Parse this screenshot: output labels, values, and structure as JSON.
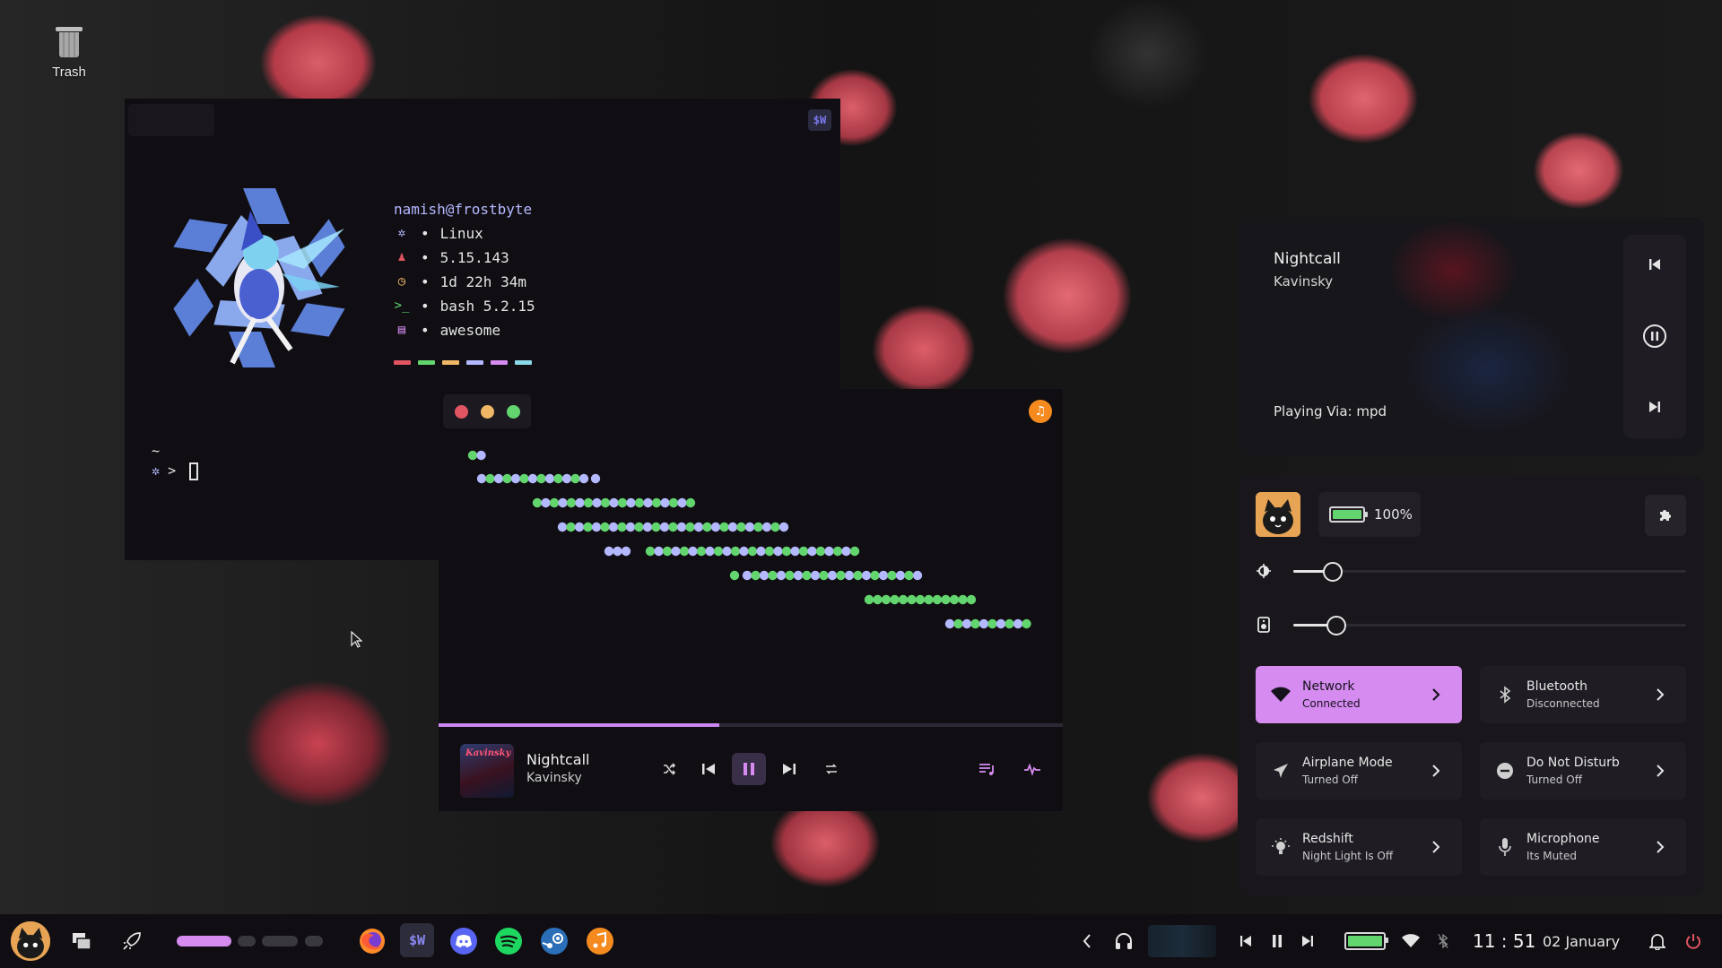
{
  "desktop": {
    "trash_label": "Trash"
  },
  "terminal": {
    "badge": "$W",
    "fetch": {
      "user_host": "namish@frostbyte",
      "rows": [
        {
          "icon": "gear-icon",
          "value": "Linux"
        },
        {
          "icon": "penguin-icon",
          "value": "5.15.143"
        },
        {
          "icon": "clock-icon",
          "value": "1d 22h 34m"
        },
        {
          "icon": "terminal-icon",
          "value": "bash 5.2.15"
        },
        {
          "icon": "window-icon",
          "value": "awesome"
        }
      ],
      "bullet": "•"
    },
    "palette": [
      "#e05561",
      "#63d56e",
      "#f0b866",
      "#b4b8ff",
      "#d58bf0",
      "#8bd9e8"
    ],
    "prompt_path": "~",
    "prompt_symbol": ">"
  },
  "player": {
    "badge": "♫",
    "track_title": "Nightcall",
    "track_artist": "Kavinsky",
    "art_text": "Kavinsky",
    "progress": 0.45
  },
  "media_widget": {
    "title": "Nightcall",
    "artist": "Kavinsky",
    "source": "Playing Via: mpd"
  },
  "control_center": {
    "battery_percent": "100%",
    "battery_level": 1.0,
    "brightness_level": 0.1,
    "volume_level": 0.11,
    "tiles": [
      {
        "name": "Network",
        "status": "Connected",
        "icon": "wifi-icon",
        "active": true
      },
      {
        "name": "Bluetooth",
        "status": "Disconnected",
        "icon": "bluetooth-icon",
        "active": false
      },
      {
        "name": "Airplane Mode",
        "status": "Turned Off",
        "icon": "airplane-icon",
        "active": false
      },
      {
        "name": "Do Not Disturb",
        "status": "Turned Off",
        "icon": "minus-circle-icon",
        "active": false
      },
      {
        "name": "Redshift",
        "status": "Night Light Is Off",
        "icon": "lightbulb-icon",
        "active": false
      },
      {
        "name": "Microphone",
        "status": "Its Muted",
        "icon": "microphone-icon",
        "active": false
      }
    ]
  },
  "taskbar": {
    "apps": [
      "firefox-icon",
      "sw-icon",
      "discord-icon",
      "spotify-icon",
      "steam-icon",
      "music-icon"
    ],
    "sw_label": "$W",
    "time": "11 : 51",
    "date": "02 January"
  },
  "colors": {
    "accent": "#d58bf0",
    "battery": "#63d56e",
    "viz_green": "#63d56e",
    "viz_purple": "#b4b8ff"
  }
}
